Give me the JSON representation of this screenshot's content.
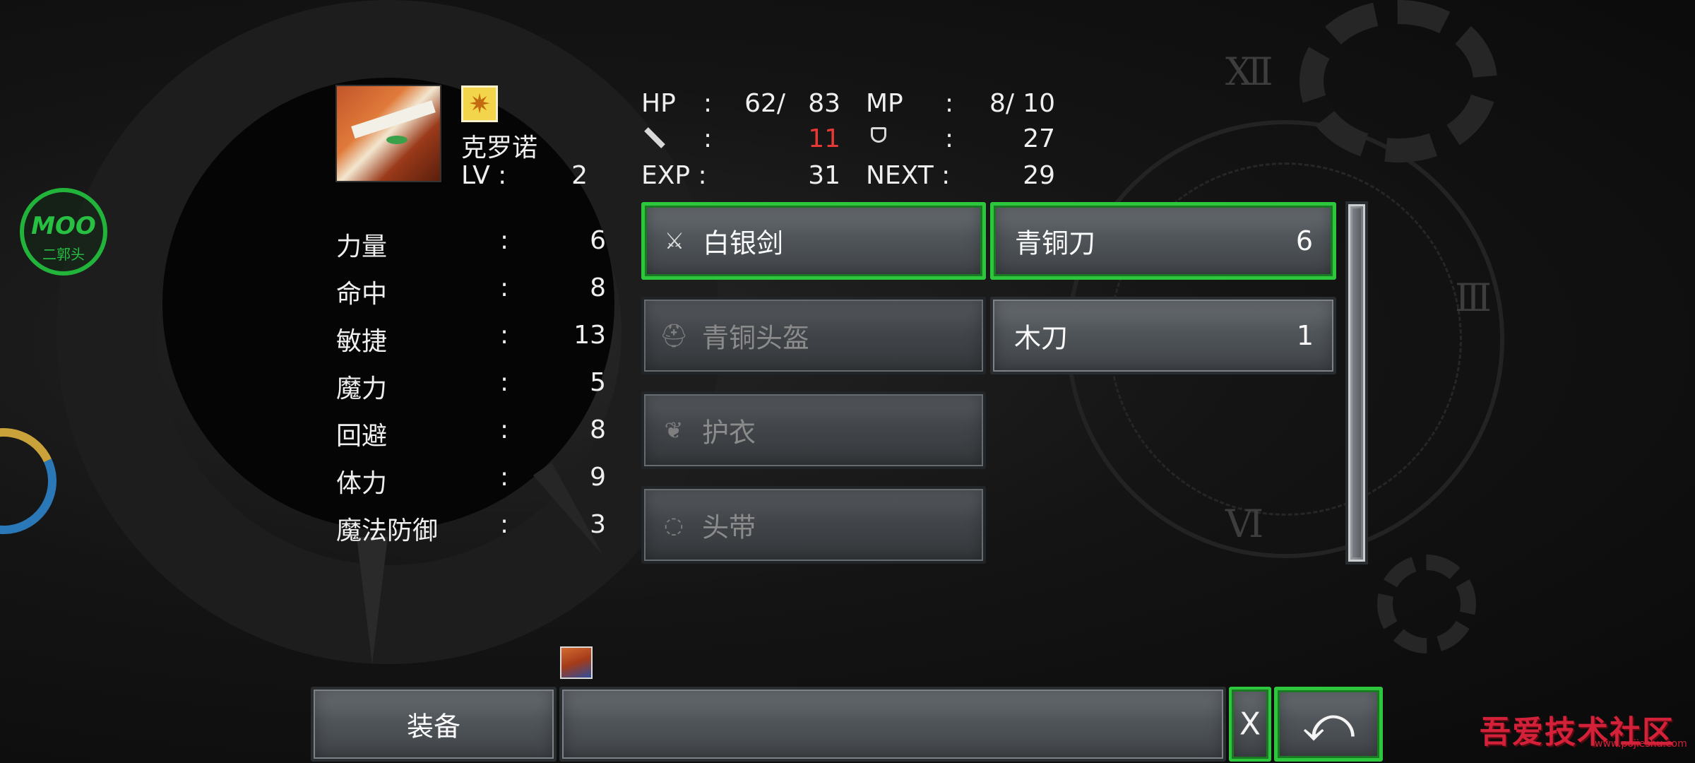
{
  "character": {
    "name": "克罗诺",
    "lv_label": "LV :",
    "lv_value": "2",
    "element_icon": "sun-element-icon"
  },
  "vitals": {
    "hp_label": "HP",
    "hp_current": "62/",
    "hp_max": "83",
    "mp_label": "MP",
    "mp_current": "8/",
    "mp_max": "10",
    "attack_value": "11",
    "attack_color": "#e53935",
    "defense_value": "27",
    "exp_label": "EXP :",
    "exp_value": "31",
    "next_label": "NEXT :",
    "next_value": "29",
    "colon": ":"
  },
  "stats": [
    {
      "label": "力量",
      "value": "6"
    },
    {
      "label": "命中",
      "value": "8"
    },
    {
      "label": "敏捷",
      "value": "13"
    },
    {
      "label": "魔力",
      "value": "5"
    },
    {
      "label": "回避",
      "value": "8"
    },
    {
      "label": "体力",
      "value": "9"
    },
    {
      "label": "魔法防御",
      "value": "3"
    }
  ],
  "equipment": [
    {
      "label": "白银剑",
      "icon": "sword-icon",
      "selected": true
    },
    {
      "label": "青铜头盔",
      "icon": "helmet-icon",
      "selected": false
    },
    {
      "label": "护衣",
      "icon": "armor-icon",
      "selected": false
    },
    {
      "label": "头带",
      "icon": "accessory-ring-icon",
      "selected": false
    }
  ],
  "items": [
    {
      "label": "青铜刀",
      "count": "6",
      "selected": true
    },
    {
      "label": "木刀",
      "count": "1",
      "selected": false
    }
  ],
  "bottom_bar": {
    "menu_label": "装备",
    "description": "",
    "x_label": "X"
  },
  "overlay": {
    "moo_title": "MOO",
    "moo_subtitle": "二郭头",
    "watermark": "吾爱技术社区",
    "watermark_url": "www.pojieshu.com"
  },
  "colors": {
    "selection_green": "#2ec63d",
    "attack_red": "#e53935"
  }
}
